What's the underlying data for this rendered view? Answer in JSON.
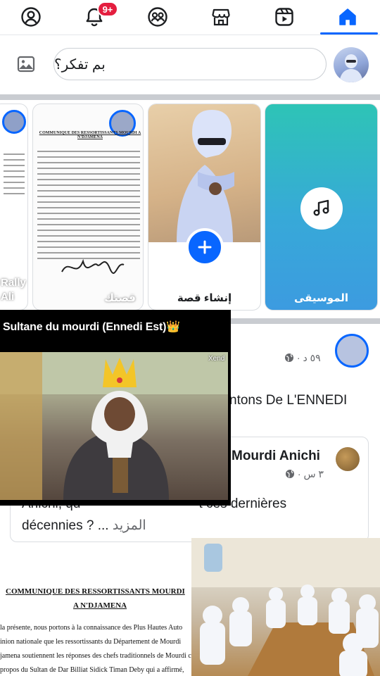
{
  "nav": {
    "items": [
      {
        "name": "profile",
        "icon": "profile-icon"
      },
      {
        "name": "notifications",
        "icon": "bell-icon",
        "badge": "9+"
      },
      {
        "name": "friends",
        "icon": "friends-icon"
      },
      {
        "name": "marketplace",
        "icon": "marketplace-icon"
      },
      {
        "name": "reels",
        "icon": "reels-icon"
      },
      {
        "name": "home",
        "icon": "home-icon",
        "active": true
      }
    ],
    "accent": "#0866ff",
    "badge_color": "#e41e3f"
  },
  "composer": {
    "placeholder": "بم تفكر؟",
    "photo_icon": "photo-icon"
  },
  "stories": {
    "partial_label": "Rally Ali",
    "doc_story_label": "قصتك",
    "doc_story_heading": "COMMUNIQUE DES RESSORTISSANTS MOURDI A N'DJAMENA",
    "create_label": "إنشاء قصة",
    "music_label": "الموسيقى",
    "music_icon": "music-note-icon",
    "music_color": "#37a9d8"
  },
  "post": {
    "time": "٥٩ د ·",
    "title_fragment": "ntons De L'ENNEDI",
    "shared": {
      "author": "Mourdi Anichi",
      "time": "٣ س ·",
      "line1_start": "Anichi, qu",
      "line1_end": "t ces dernières",
      "line2": "décennies ? ...",
      "see_more": "المزيد"
    },
    "document": {
      "heading1": "COMMUNIQUE DES RESSORTISSANTS MOURDI",
      "heading2": "A N'DJAMENA",
      "lines": [
        "la présente, nous portons à la connaissance des Plus Hautes Auto",
        "inion nationale que les ressortissants du Département de Mourdi",
        "jamena soutiennent les réponses des chefs traditionnels de Mourdi con",
        "propos du Sultan de Dar Billiat Sidick Timan Deby qui a affirmé,"
      ]
    }
  },
  "overlay": {
    "caption": "Sultane du mourdi (Ennedi Est)👑",
    "watermark": "Xend"
  }
}
